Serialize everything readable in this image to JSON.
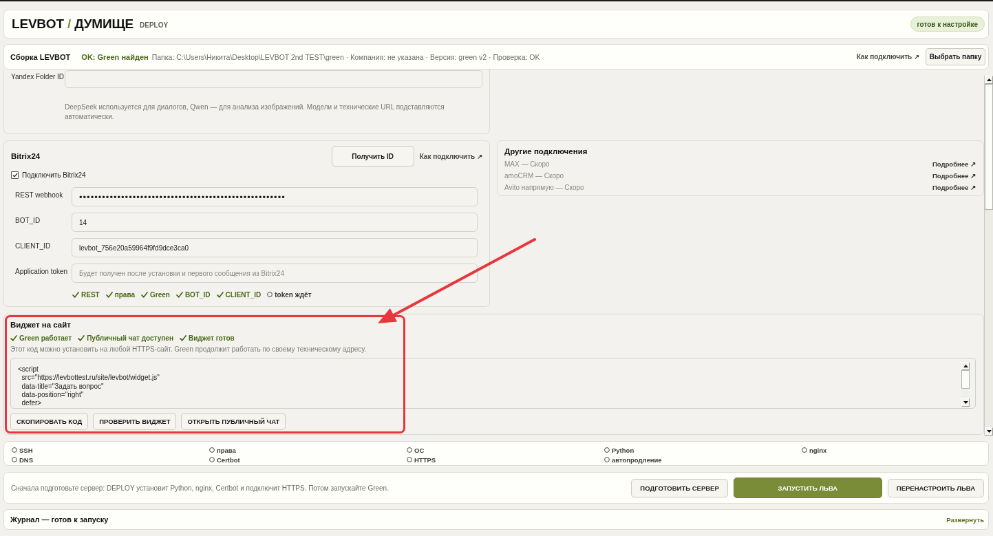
{
  "header": {
    "brand": {
      "name": "LEVBOT",
      "separator": "/",
      "product": "ДУМИЩЕ"
    },
    "tag": "DEPLOY",
    "status_badge": "готов к настройке"
  },
  "build_bar": {
    "title": "Сборка LEVBOT",
    "status": "OK: Green найден",
    "details": "Папка: C:\\Users\\Никита\\Desktop\\LEVBOT 2nd TEST\\green · Компания: не указана · Версия: green v2 · Проверка: OK",
    "help_link": "Как подключить ↗",
    "button": "Выбрать папку"
  },
  "ai_settings": {
    "fields": [
      {
        "label": "Yandex Folder ID"
      }
    ],
    "note": "DeepSeek используется для диалогов, Qwen — для анализа изображений. Модели и технические URL подставляются автоматически."
  },
  "bitrix": {
    "title": "Bitrix24",
    "button": "Получить ID",
    "help_link": "Как подключить ↗",
    "enable": {
      "label": "Подключить Bitrix24",
      "checked": true
    },
    "fields": [
      {
        "label": "REST webhook",
        "kind": "secret",
        "value": "••••••••••••••••••••••••••••••••••••••••••••••••••••••"
      },
      {
        "label": "BOT_ID",
        "kind": "text",
        "value": "14"
      },
      {
        "label": "CLIENT_ID",
        "kind": "text",
        "value": "levbot_756e20a59964f9fd9dce3ca0"
      },
      {
        "label": "Application token",
        "kind": "text",
        "placeholder": "Будет получен после установки и первого сообщения из Bitrix24"
      }
    ],
    "checks": [
      {
        "label": "REST",
        "done": true
      },
      {
        "label": "права",
        "done": true
      },
      {
        "label": "Green",
        "done": true
      },
      {
        "label": "BOT_ID",
        "done": true
      },
      {
        "label": "CLIENT_ID",
        "done": true
      },
      {
        "label": "token ждёт",
        "done": false
      }
    ]
  },
  "other_connections": {
    "title": "Другие подключения",
    "items": [
      {
        "label": "MAX — Скоро",
        "link": "Подробнее ↗"
      },
      {
        "label": "amoCRM — Скоро",
        "link": "Подробнее ↗"
      },
      {
        "label": "Avito напрямую — Скоро",
        "link": "Подробнее ↗"
      }
    ]
  },
  "widget": {
    "title": "Виджет на сайт",
    "checks": [
      {
        "label": "Green работает",
        "done": true
      },
      {
        "label": "Публичный чат доступен",
        "done": true
      },
      {
        "label": "Виджет готов",
        "done": true
      }
    ],
    "note": "Этот код можно установить на любой HTTPS-сайт. Green продолжит работать по своему техническому адресу.",
    "code": "<script\n  src=\"https://levbottest.ru/site/levbot/widget.js\"\n  data-title=\"Задать вопрос\"\n  data-position=\"right\"\n  defer>",
    "buttons": [
      "СКОПИРОВАТЬ КОД",
      "ПРОВЕРИТЬ ВИДЖЕТ",
      "ОТКРЫТЬ ПУБЛИЧНЫЙ ЧАТ"
    ]
  },
  "server_checks": [
    {
      "label": "SSH",
      "done": false
    },
    {
      "label": "права",
      "done": false
    },
    {
      "label": "ОС",
      "done": false
    },
    {
      "label": "Python",
      "done": false
    },
    {
      "label": "nginx",
      "done": false
    },
    {
      "label": "DNS",
      "done": false
    },
    {
      "label": "Certbot",
      "done": false
    },
    {
      "label": "HTTPS",
      "done": false
    },
    {
      "label": "автопродление",
      "done": false
    }
  ],
  "actions": {
    "hint": "Сначала подготовьте сервер: DEPLOY установит Python, nginx, Certbot и подключит HTTPS. Потом запускайте Green.",
    "buttons": [
      {
        "label": "ПОДГОТОВИТЬ СЕРВЕР",
        "kind": "secondary"
      },
      {
        "label": "ЗАПУСТИТЬ ЛЬВА",
        "kind": "primary"
      },
      {
        "label": "ПЕРЕНАСТРОИТЬ ЛЬВА",
        "kind": "secondary"
      }
    ]
  },
  "journal": {
    "title": "Журнал — готов к запуску",
    "toggle": "Развернуть"
  }
}
